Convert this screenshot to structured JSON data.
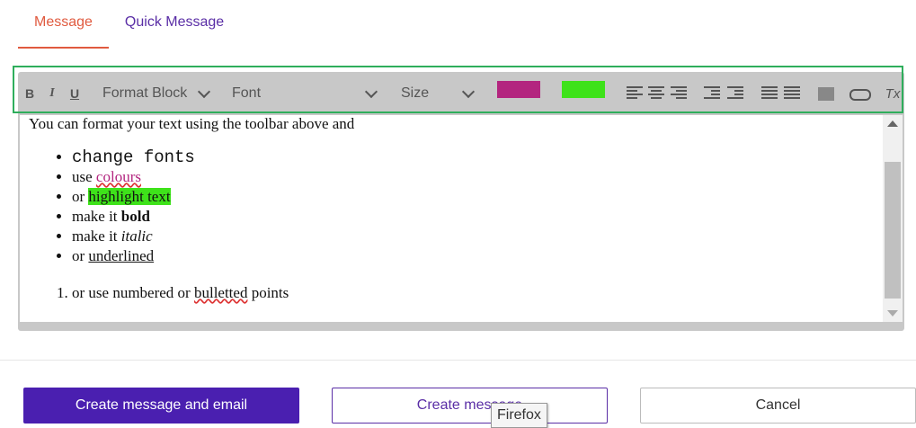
{
  "tabs": {
    "message": "Message",
    "quick_message": "Quick Message"
  },
  "toolbar": {
    "bold": "B",
    "italic": "I",
    "underline": "U",
    "format_block": "Format Block",
    "font": "Font",
    "size": "Size",
    "text_color": "#b3257f",
    "highlight_color": "#3ee21a",
    "icons": [
      "align-left-icon",
      "align-center-icon",
      "align-right-icon",
      "outdent-icon",
      "indent-icon",
      "bullet-list-icon",
      "numbered-list-icon",
      "image-icon",
      "link-icon",
      "clear-format-icon"
    ],
    "clear_format": "Tx"
  },
  "content": {
    "intro": "You can format your text  using the toolbar above and",
    "bullets": {
      "b1": "change fonts",
      "b2_prefix": "use ",
      "b2_colour": "colours",
      "b3_prefix": "or ",
      "b3_highlight": "highlight text",
      "b4_prefix": "make it ",
      "b4_bold": "bold",
      "b5_prefix": "make it ",
      "b5_italic": "italic",
      "b6_prefix": "or ",
      "b6_underline": "underlined"
    },
    "numbered": {
      "n1_prefix": "or use numbered or ",
      "n1_wavy": "bulletted",
      "n1_suffix": " points"
    }
  },
  "buttons": {
    "create_email": "Create message and email",
    "create": "Create message",
    "cancel": "Cancel"
  },
  "tooltip": "Firefox"
}
